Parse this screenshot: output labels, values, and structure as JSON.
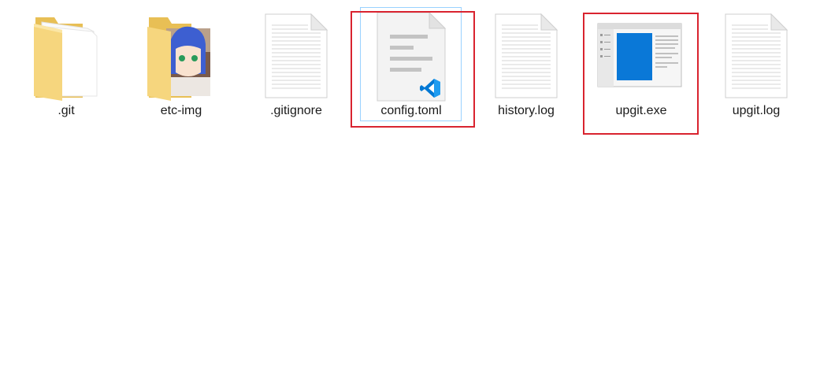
{
  "files": [
    {
      "name": ".git",
      "icon": "folder-icon"
    },
    {
      "name": "etc-img",
      "icon": "image-folder-icon"
    },
    {
      "name": ".gitignore",
      "icon": "text-file-icon"
    },
    {
      "name": "config.toml",
      "icon": "vscode-file-icon",
      "selected": true,
      "highlighted": true
    },
    {
      "name": "history.log",
      "icon": "text-file-icon"
    },
    {
      "name": "upgit.exe",
      "icon": "exe-app-icon",
      "highlighted": true
    },
    {
      "name": "upgit.log",
      "icon": "text-file-icon"
    }
  ],
  "colors": {
    "highlight": "#d9232f",
    "selection": "#99d1ff",
    "folder": "#f4d272",
    "vscode_blue": "#0078d4"
  }
}
